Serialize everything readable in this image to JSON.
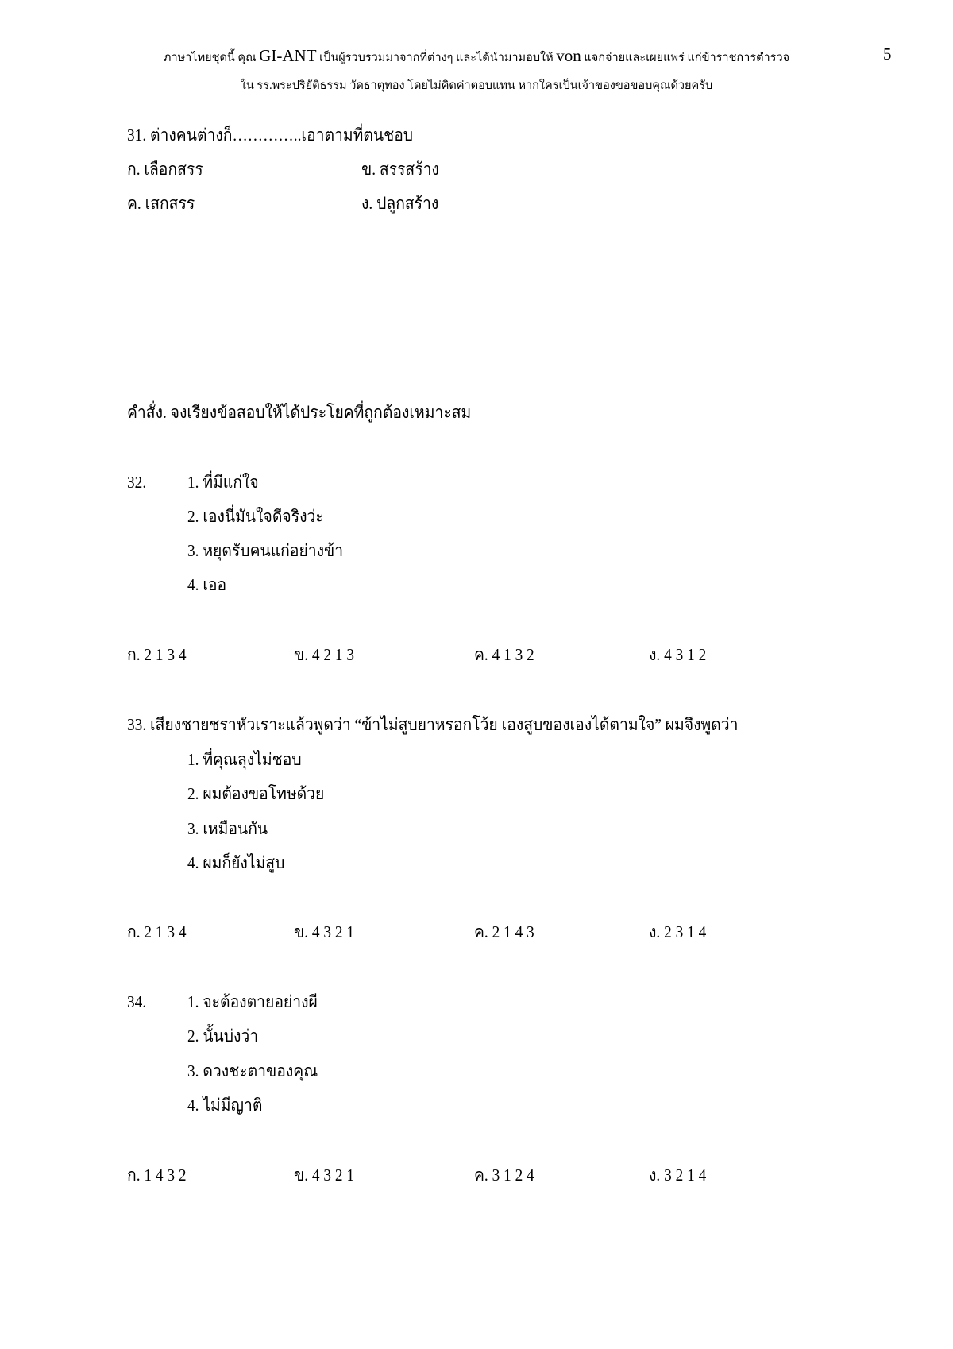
{
  "header": {
    "line1_a": "ภาษาไทยชุดนี้ คุณ ",
    "line1_brand": "GI-ANT",
    "line1_b": " เป็นผู้รวบรวมมาจากที่ต่างๆ และได้นำมามอบให้ ",
    "line1_name": "von",
    "line1_c": " แจกจ่ายและเผยแพร่ แก่ข้าราชการตำรวจ",
    "line2": "ใน รร.พระปริยัติธรรม วัดธาตุทอง โดยไม่คิดค่าตอบแทน หากใครเป็นเจ้าของขอขอบคุณด้วยครับ",
    "page_number": "5"
  },
  "q31": {
    "question": "31. ต่างคนต่างก็…………..เอาตามที่ตนชอบ",
    "options": [
      "ก. เลือกสรร",
      "ข. สรรสร้าง",
      "ค. เสกสรร",
      "ง. ปลูกสร้าง"
    ]
  },
  "instruction": "คำสั่ง. จงเรียงข้อสอบให้ได้ประโยคที่ถูกต้องเหมาะสม",
  "q32": {
    "number": "32.",
    "items": [
      "1. ที่มีแก่ใจ",
      "2. เองนี่มันใจดีจริงว่ะ",
      "3. หยุดรับคนแก่อย่างข้า",
      "4. เออ"
    ],
    "answers": [
      "ก. 2 1 3 4",
      "ข. 4 2 1 3",
      "ค. 4 1 3 2",
      "ง. 4 3 1 2"
    ]
  },
  "q33": {
    "question": "33. เสียงชายชราหัวเราะแล้วพูดว่า “ข้าไม่สูบยาหรอกโว้ย เองสูบของเองได้ตามใจ” ผมจึงพูดว่า",
    "items": [
      "1. ที่คุณลุงไม่ชอบ",
      "2. ผมต้องขอโทษด้วย",
      "3. เหมือนกัน",
      "4. ผมก็ยังไม่สูบ"
    ],
    "answers": [
      "ก. 2 1 3 4",
      "ข. 4 3 2 1",
      "ค. 2 1 4 3",
      "ง. 2 3 1 4"
    ]
  },
  "q34": {
    "number": "34.",
    "items": [
      "1. จะต้องตายอย่างผี",
      "2. นั้นบ่งว่า",
      "3. ดวงชะตาของคุณ",
      "4. ไม่มีญาติ"
    ],
    "answers": [
      "ก. 1 4 3 2",
      "ข. 4 3 2 1",
      "ค. 3 1 2 4",
      "ง. 3 2 1 4"
    ]
  }
}
